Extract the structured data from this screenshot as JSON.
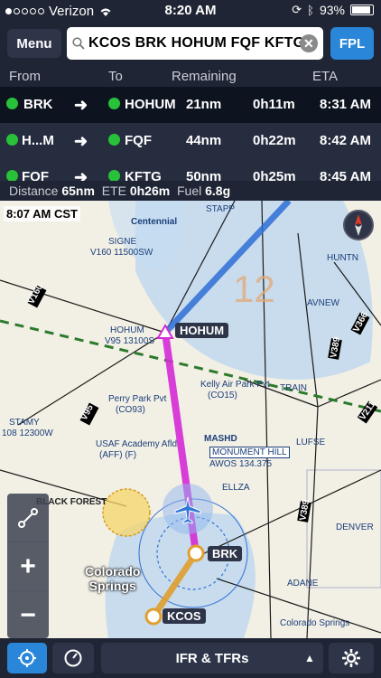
{
  "status": {
    "carrier": "Verizon",
    "time": "8:20 AM",
    "battery": "93%",
    "battery_level": 0.93
  },
  "toolbar": {
    "menu_label": "Menu",
    "route": "KCOS BRK HOHUM FQF KFTG",
    "fpl_label": "FPL"
  },
  "nav_header": {
    "from": "From",
    "to": "To",
    "remaining": "Remaining",
    "eta": "ETA"
  },
  "legs": [
    {
      "from": "BRK",
      "to": "HOHUM",
      "distance": "21nm",
      "time": "0h11m",
      "eta": "8:31 AM"
    },
    {
      "from": "H...M",
      "to": "FQF",
      "distance": "44nm",
      "time": "0h22m",
      "eta": "8:42 AM"
    },
    {
      "from": "FQF",
      "to": "KFTG",
      "distance": "50nm",
      "time": "0h25m",
      "eta": "8:45 AM"
    }
  ],
  "summary": {
    "distance_label": "Distance",
    "distance": "65nm",
    "ete_label": "ETE",
    "ete": "0h26m",
    "fuel_label": "Fuel",
    "fuel": "6.8g"
  },
  "map": {
    "time_badge": "8:07 AM CST",
    "waypoints": {
      "hohum": "HOHUM",
      "brk": "BRK",
      "kcos": "KCOS"
    },
    "city": "Colorado\nSprings",
    "labels": {
      "centennial": "Centennial",
      "signe": "SIGNE",
      "signe_alt": "V160 11500SW",
      "hohum_alt": "HOHUM",
      "hohum_v": "V95 13100S",
      "stamy": "STAMY",
      "stamy_alt": "108 12300W",
      "perry_park": "Perry Park Pvt",
      "perry_code": "(CO93)",
      "kelly_air": "Kelly Air Park Pvt",
      "kelly_code": "(CO15)",
      "mashd": "MASHD",
      "monument": "MONUMENT HILL",
      "awos": "AWOS 134.375",
      "usaf": "USAF Academy Afld",
      "usaf_code": "(AFF) (F)",
      "black_forest": "BLACK FOREST",
      "lufse": "LUFSE",
      "ellza": "ELLZA",
      "adane": "ADANE",
      "huntn": "HUNTN",
      "avnew": "AVNEW",
      "train": "TRAIN",
      "stapp": "STAPP",
      "big_num": "12",
      "denver": "DENVER",
      "v160": "V160",
      "v95": "V95",
      "v389": "V389",
      "v366": "V366",
      "v211": "V211",
      "colorado_springs_small": "Colorado Springs"
    }
  },
  "bottom": {
    "layer_label": "IFR & TFRs"
  },
  "colors": {
    "route_blue": "#2f6fd6",
    "route_magenta": "#d62bd6",
    "route_orange": "#e0a030",
    "airspace": "#b9d5ef",
    "accent": "#2a86d8",
    "active_dot": "#28c13a"
  },
  "icons": [
    "search-icon",
    "clear-icon",
    "arrow-right-icon",
    "compass-icon",
    "route-icon",
    "zoom-in-icon",
    "zoom-out-icon",
    "locate-icon",
    "gauge-icon",
    "chevron-up-icon",
    "gear-icon",
    "airplane-icon",
    "wifi-icon",
    "bluetooth-icon",
    "battery-icon",
    "lock-rotation-icon"
  ]
}
